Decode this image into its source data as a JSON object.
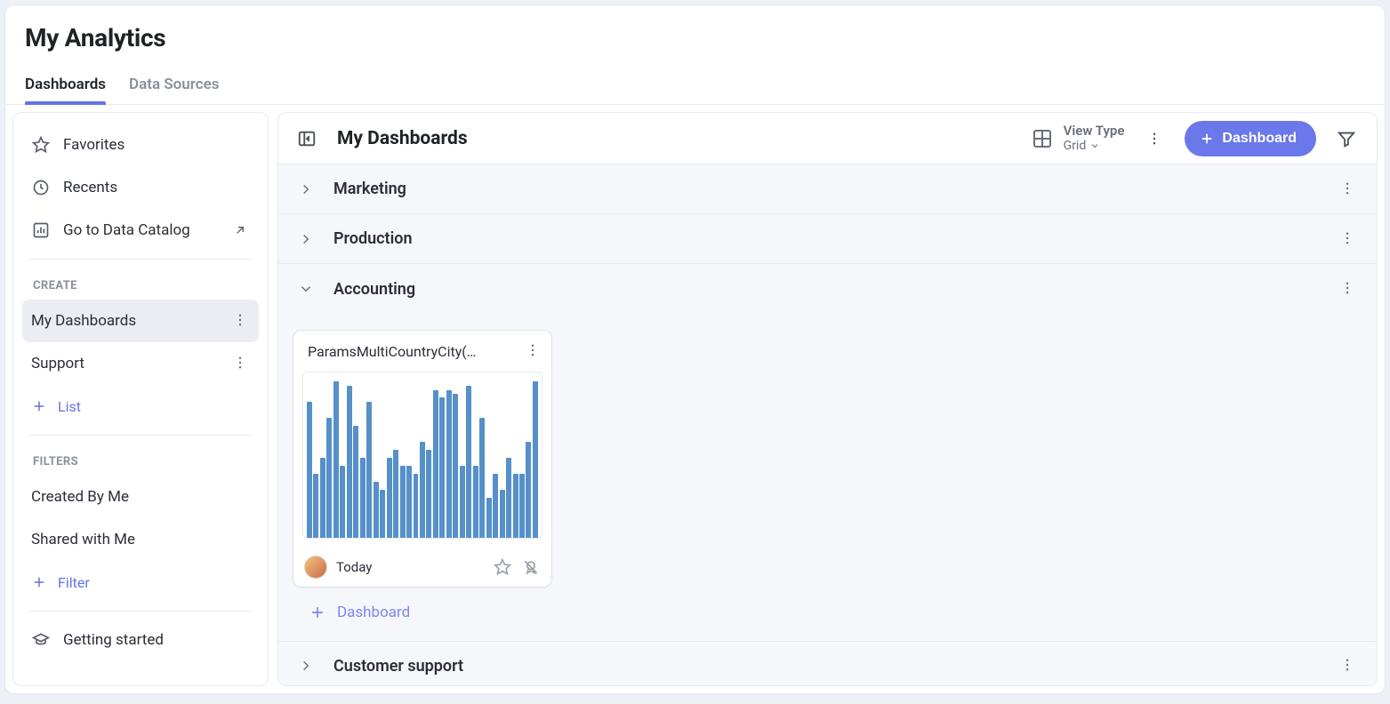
{
  "header": {
    "title": "My Analytics",
    "tabs": [
      {
        "label": "Dashboards",
        "active": true
      },
      {
        "label": "Data Sources",
        "active": false
      }
    ]
  },
  "sidebar": {
    "quick": {
      "favorites": "Favorites",
      "recents": "Recents",
      "catalog": "Go to Data Catalog"
    },
    "sections": {
      "create_heading": "CREATE",
      "filters_heading": "FILTERS"
    },
    "create_items": [
      {
        "label": "My Dashboards",
        "selected": true
      },
      {
        "label": "Support",
        "selected": false
      }
    ],
    "add_list": "List",
    "filter_items": [
      {
        "label": "Created By Me"
      },
      {
        "label": "Shared with Me"
      }
    ],
    "add_filter": "Filter",
    "getting_started": "Getting started"
  },
  "main": {
    "title": "My Dashboards",
    "view_type_label": "View Type",
    "view_type_selected": "Grid",
    "new_dashboard_btn": "Dashboard",
    "groups": [
      {
        "id": "marketing",
        "label": "Marketing",
        "expanded": false
      },
      {
        "id": "production",
        "label": "Production",
        "expanded": false
      },
      {
        "id": "accounting",
        "label": "Accounting",
        "expanded": true
      },
      {
        "id": "customer_support",
        "label": "Customer support",
        "expanded": false
      }
    ],
    "accounting": {
      "card": {
        "title": "ParamsMultiCountryCity(…",
        "date": "Today"
      },
      "add_dashboard": "Dashboard"
    }
  },
  "chart_data": {
    "type": "bar",
    "title": "ParamsMultiCountryCity",
    "xlabel": "",
    "ylabel": "",
    "ylim": [
      0,
      100
    ],
    "values": [
      85,
      40,
      50,
      75,
      98,
      45,
      95,
      70,
      50,
      85,
      35,
      30,
      50,
      55,
      45,
      45,
      40,
      60,
      55,
      92,
      88,
      92,
      90,
      45,
      95,
      45,
      75,
      25,
      40,
      30,
      50,
      40,
      40,
      60,
      98
    ]
  }
}
